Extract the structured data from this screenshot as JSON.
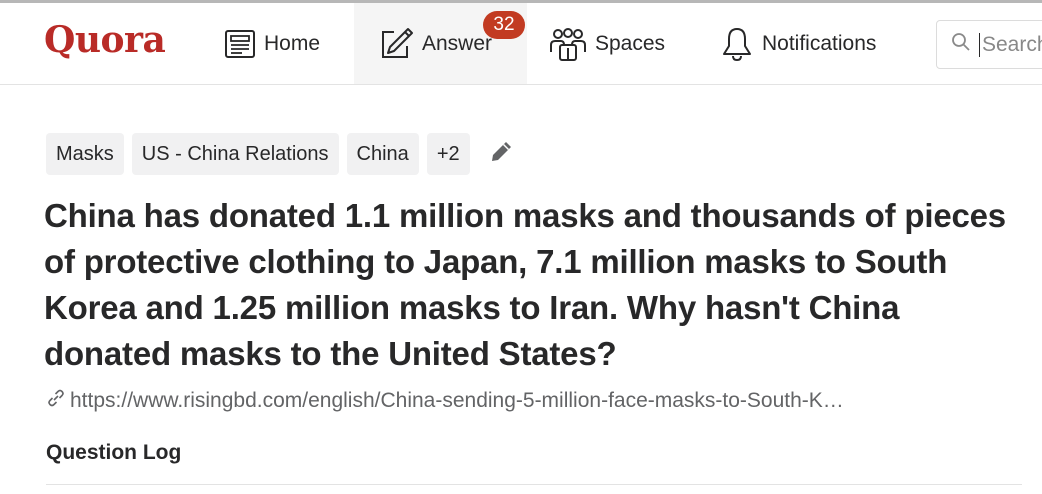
{
  "header": {
    "logo": "Quora",
    "nav": {
      "home_label": "Home",
      "answer_label": "Answer",
      "answer_badge": "32",
      "spaces_label": "Spaces",
      "notifications_label": "Notifications"
    },
    "search": {
      "placeholder": "Search Quora"
    }
  },
  "question": {
    "topics": [
      "Masks",
      "US - China Relations",
      "China",
      "+2"
    ],
    "title": "China has donated 1.1 million masks and thousands of pieces of protective clothing to Japan, 7.1 million masks to South Korea and 1.25 million masks to Iran. Why hasn't China donated masks to the United States?",
    "source_url": "https://www.risingbd.com/english/China-sending-5-million-face-masks-to-South-K…",
    "log_label": "Question Log"
  },
  "colors": {
    "brand": "#b92b27",
    "badge": "#c23b22",
    "text": "#282829",
    "muted": "#636466",
    "chip_bg": "#f1f1f2"
  },
  "icons": {
    "home": "home-icon",
    "answer": "pencil-square-icon",
    "spaces": "people-group-icon",
    "notifications": "bell-icon",
    "search": "search-icon",
    "edit": "pencil-icon",
    "link": "link-icon"
  }
}
